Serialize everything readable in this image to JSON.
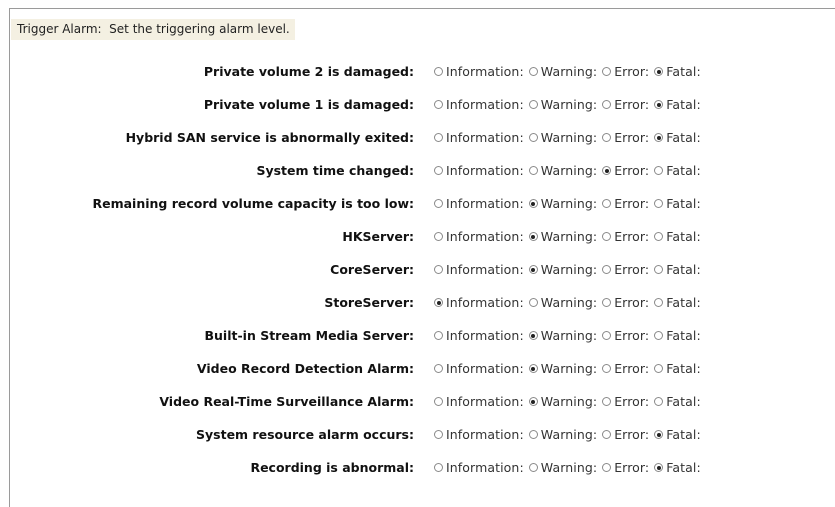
{
  "header": {
    "text": "Trigger Alarm:  Set the triggering alarm level."
  },
  "options": [
    "Information:",
    "Warning:",
    "Error:",
    "Fatal:"
  ],
  "rows": [
    {
      "label": "Private volume 2 is damaged:",
      "selected": "Fatal:"
    },
    {
      "label": "Private volume 1 is damaged:",
      "selected": "Fatal:"
    },
    {
      "label": "Hybrid SAN service is abnormally exited:",
      "selected": "Fatal:"
    },
    {
      "label": "System time changed:",
      "selected": "Error:"
    },
    {
      "label": "Remaining record volume capacity is too low:",
      "selected": "Warning:"
    },
    {
      "label": "HKServer:",
      "selected": "Warning:"
    },
    {
      "label": "CoreServer:",
      "selected": "Warning:"
    },
    {
      "label": "StoreServer:",
      "selected": "Information:"
    },
    {
      "label": "Built-in Stream Media Server:",
      "selected": "Warning:"
    },
    {
      "label": "Video Record Detection Alarm:",
      "selected": "Warning:"
    },
    {
      "label": "Video Real-Time Surveillance Alarm:",
      "selected": "Warning:"
    },
    {
      "label": "System resource alarm occurs:",
      "selected": "Fatal:"
    },
    {
      "label": "Recording is abnormal:",
      "selected": "Fatal:"
    }
  ]
}
